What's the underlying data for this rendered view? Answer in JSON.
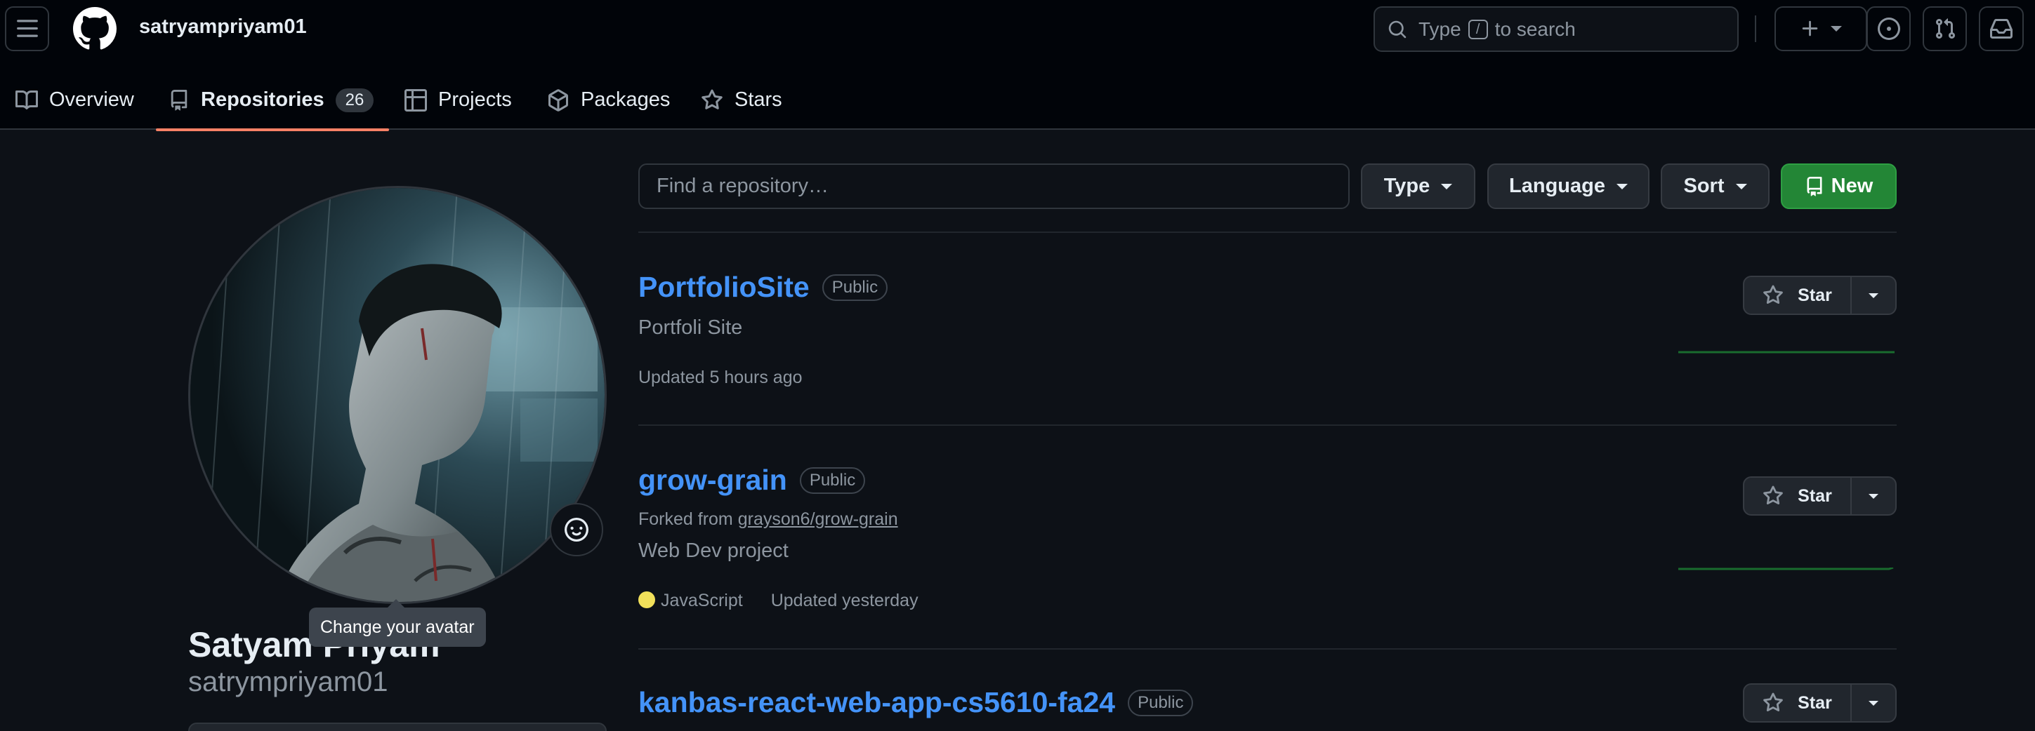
{
  "header": {
    "username": "satryampriyam01",
    "search": {
      "prefix": "Type",
      "key": "/",
      "suffix": "to search"
    }
  },
  "tabs": [
    {
      "label": "Overview",
      "icon": "book-icon"
    },
    {
      "label": "Repositories",
      "icon": "repo-icon",
      "count": "26",
      "active": true
    },
    {
      "label": "Projects",
      "icon": "table-icon"
    },
    {
      "label": "Packages",
      "icon": "package-icon"
    },
    {
      "label": "Stars",
      "icon": "star-icon"
    }
  ],
  "profile": {
    "display_name": "Satyam Priyam",
    "login": "satrympriyam01",
    "avatar_tooltip": "Change your avatar"
  },
  "filters": {
    "search_placeholder": "Find a repository…",
    "type_label": "Type",
    "language_label": "Language",
    "sort_label": "Sort",
    "new_label": "New"
  },
  "repos": [
    {
      "name": "PortfolioSite",
      "visibility": "Public",
      "description": "Portfoli Site",
      "updated": "Updated 5 hours ago",
      "star_label": "Star"
    },
    {
      "name": "grow-grain",
      "visibility": "Public",
      "forked_prefix": "Forked from",
      "forked_from": "grayson6/grow-grain",
      "description": "Web Dev project",
      "language": "JavaScript",
      "language_color": "#f1e05a",
      "updated": "Updated yesterday",
      "star_label": "Star"
    },
    {
      "name": "kanbas-react-web-app-cs5610-fa24",
      "visibility": "Public",
      "star_label": "Star"
    }
  ],
  "colors": {
    "accent_link": "#4493f8",
    "new_button": "#238636",
    "active_tab_underline": "#f78166",
    "activity_line": "#196c2e"
  }
}
